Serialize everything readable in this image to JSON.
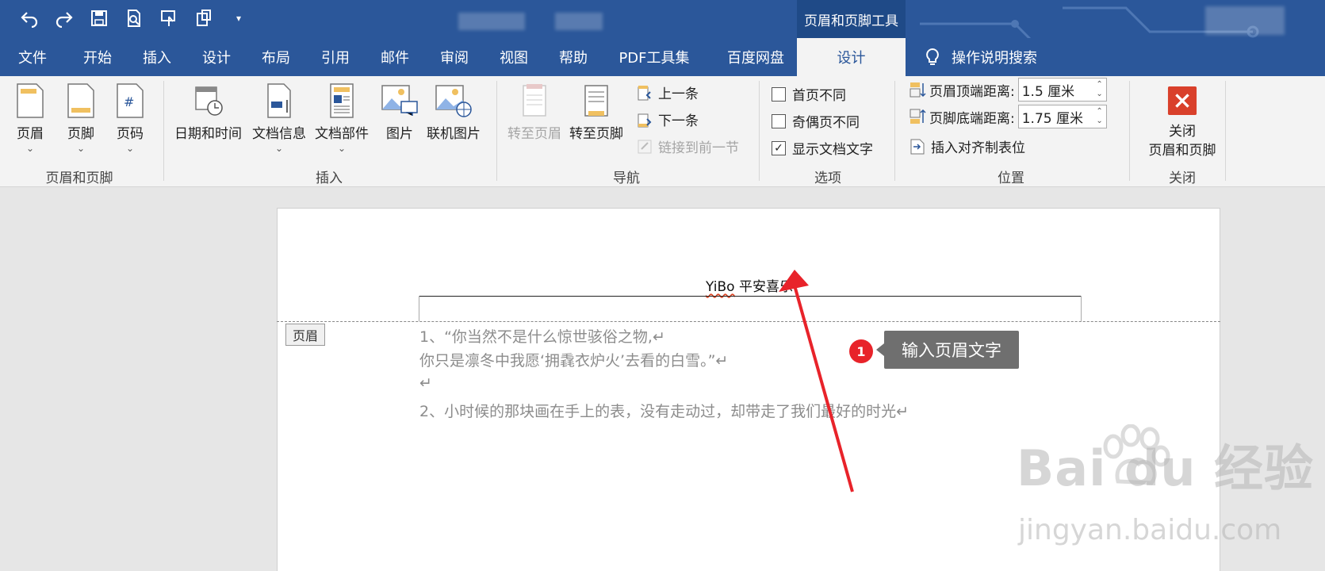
{
  "window": {
    "context_tab_group": "页眉和页脚工具"
  },
  "tabs": [
    {
      "label": "文件"
    },
    {
      "label": "开始"
    },
    {
      "label": "插入"
    },
    {
      "label": "设计"
    },
    {
      "label": "布局"
    },
    {
      "label": "引用"
    },
    {
      "label": "邮件"
    },
    {
      "label": "审阅"
    },
    {
      "label": "视图"
    },
    {
      "label": "帮助"
    },
    {
      "label": "PDF工具集"
    },
    {
      "label": "百度网盘"
    },
    {
      "label": "设计",
      "active": true
    }
  ],
  "tell_me": "操作说明搜索",
  "ribbon": {
    "group_header_footer": {
      "label": "页眉和页脚",
      "buttons": [
        "页眉",
        "页脚",
        "页码"
      ]
    },
    "group_insert": {
      "label": "插入",
      "buttons": [
        "日期和时间",
        "文档信息",
        "文档部件",
        "图片",
        "联机图片"
      ]
    },
    "group_nav": {
      "label": "导航",
      "goto_header": "转至页眉",
      "goto_footer": "转至页脚",
      "previous": "上一条",
      "next": "下一条",
      "link_previous": "链接到前一节"
    },
    "group_options": {
      "label": "选项",
      "different_first": "首页不同",
      "different_odd_even": "奇偶页不同",
      "show_doc_text": "显示文档文字",
      "show_doc_text_checked": true
    },
    "group_position": {
      "label": "位置",
      "header_top_label": "页眉顶端距离:",
      "header_top_value": "1.5 厘米",
      "footer_bottom_label": "页脚底端距离:",
      "footer_bottom_value": "1.75 厘米",
      "insert_align_tab": "插入对齐制表位"
    },
    "group_close": {
      "label": "关闭",
      "button_line1": "关闭",
      "button_line2": "页眉和页脚"
    }
  },
  "document": {
    "header_text_latin": "YiBo",
    "header_text_cjk": " 平安喜乐",
    "header_tag": "页眉",
    "lines": [
      "1、“你当然不是什么惊世骇俗之物,↵",
      "你只是凛冬中我愿‘拥毳衣炉火’去看的白雪。”↵",
      "↵",
      "2、小时候的那块画在手上的表，没有走动过，却带走了我们最好的时光↵"
    ]
  },
  "annotation": {
    "number": "1",
    "text": "输入页眉文字"
  },
  "watermark": {
    "brand": "Bai du 经验",
    "url": "jingyan.baidu.com"
  },
  "colors": {
    "ribbon_blue": "#2b579a",
    "annotation_red": "#e8232a"
  }
}
